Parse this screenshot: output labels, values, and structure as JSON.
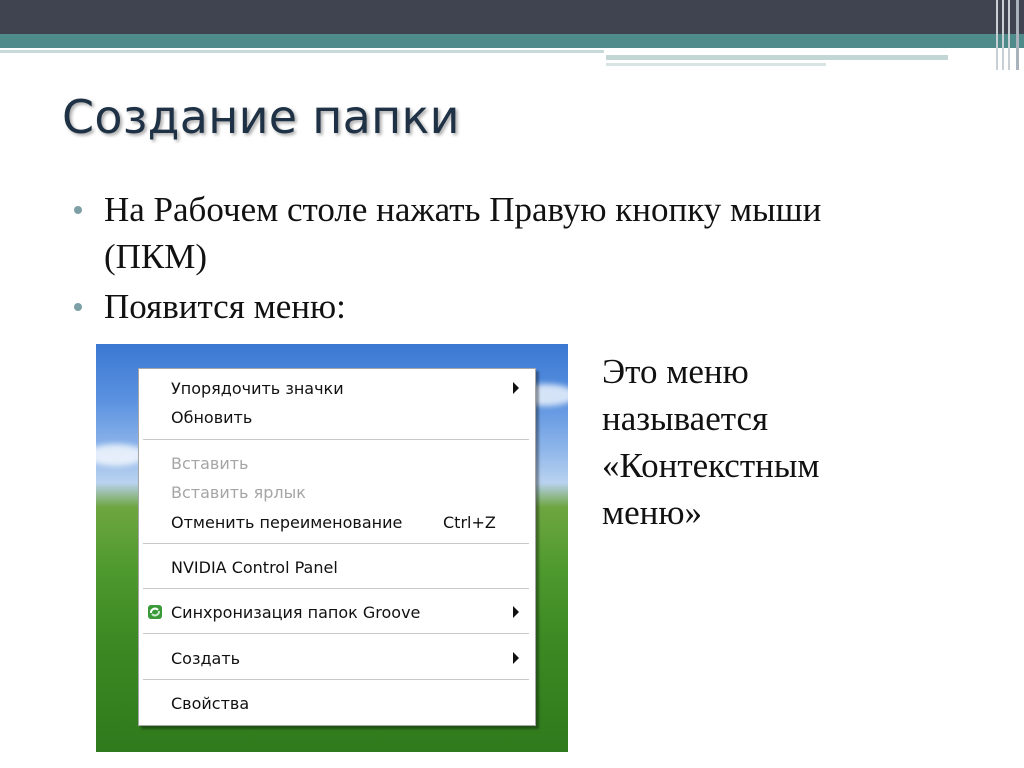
{
  "slide": {
    "title": "Создание папки",
    "bullets": [
      "На Рабочем столе нажать Правую кнопку мыши (ПКМ)",
      "Появится меню:"
    ],
    "side_text": [
      "Это меню",
      "называется",
      "«Контекстным",
      "меню»"
    ]
  },
  "context_menu": {
    "items": [
      {
        "label": "Упорядочить значки",
        "submenu": true
      },
      {
        "label": "Обновить"
      },
      {
        "label": "Вставить",
        "disabled": true
      },
      {
        "label": "Вставить ярлык",
        "disabled": true
      },
      {
        "label": "Отменить переименование",
        "shortcut": "Ctrl+Z"
      },
      {
        "label": "NVIDIA Control Panel"
      },
      {
        "label": "Синхронизация папок Groove",
        "submenu": true,
        "icon": "groove-sync-icon"
      },
      {
        "label": "Создать",
        "submenu": true
      },
      {
        "label": "Свойства"
      }
    ]
  },
  "colors": {
    "title": "#1e3145",
    "bullet_dot": "#7ca0a6",
    "top_band": "#3f4450",
    "teal_stripe": "#4e8b8a",
    "menu_disabled": "#a5a5a5",
    "groove_icon": "#3a9a3a"
  }
}
